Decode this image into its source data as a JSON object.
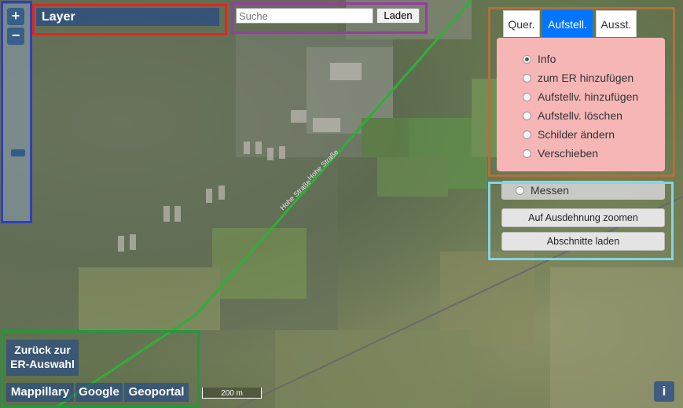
{
  "map": {
    "roads": [
      "Hohe Straße",
      "Hohe Straße"
    ]
  },
  "zoom": {
    "in_label": "+",
    "out_label": "−"
  },
  "layer": {
    "label": "Layer"
  },
  "search": {
    "placeholder": "Suche",
    "value": "",
    "load_label": "Laden"
  },
  "tabs": [
    {
      "label": "Quer.",
      "active": false
    },
    {
      "label": "Aufstell.",
      "active": true
    },
    {
      "label": "Ausst.",
      "active": false
    }
  ],
  "options": [
    {
      "label": "Info",
      "selected": true
    },
    {
      "label": "zum ER hinzufügen",
      "selected": false
    },
    {
      "label": "Aufstellv. hinzufügen",
      "selected": false
    },
    {
      "label": "Aufstellv. löschen",
      "selected": false
    },
    {
      "label": "Schilder ändern",
      "selected": false
    },
    {
      "label": "Verschieben",
      "selected": false
    }
  ],
  "tools": {
    "measure_label": "Messen",
    "zoom_extent_label": "Auf Ausdehnung zoomen",
    "load_sections_label": "Abschnitte laden"
  },
  "bottom": {
    "back_line1": "Zurück zur",
    "back_line2": "ER-Auswahl",
    "links": [
      "Mappillary",
      "Google",
      "Geoportal"
    ],
    "scale_label": "200 m",
    "info_label": "i"
  },
  "colors": {
    "active_tab": "#0075ff",
    "panel": "#f6b6b6",
    "button_blue": "#1e468c",
    "rail": "#2fae3a"
  }
}
